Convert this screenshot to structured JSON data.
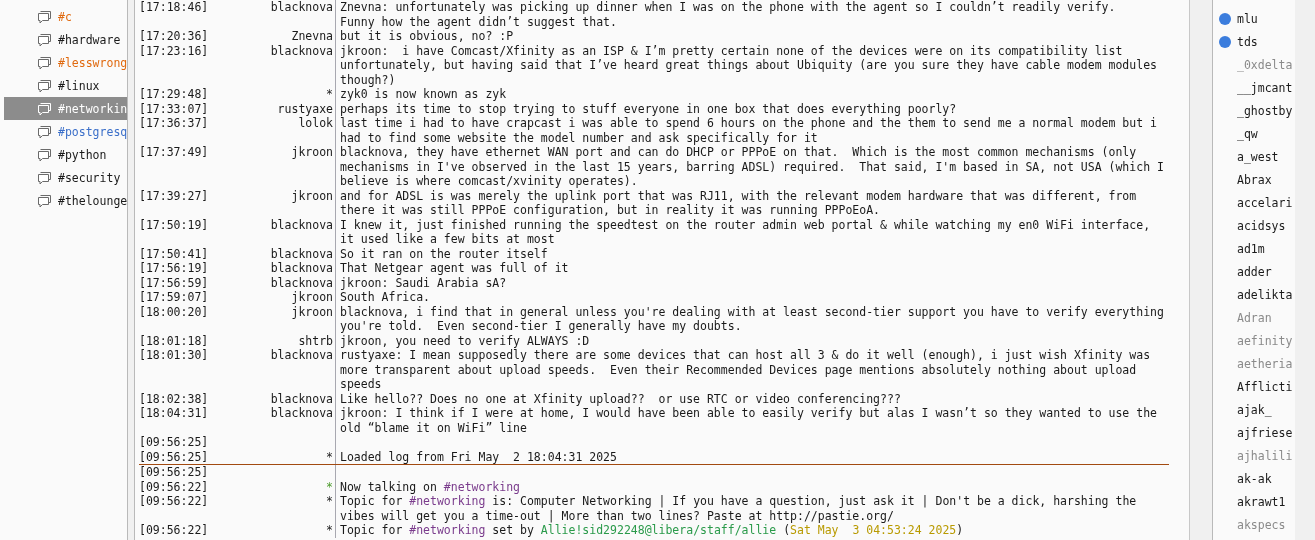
{
  "channels": [
    {
      "name": "#c",
      "color": "#e06a10",
      "selected": false
    },
    {
      "name": "#hardware",
      "color": "#1a1a1a",
      "selected": false
    },
    {
      "name": "#lesswrong",
      "color": "#e06a10",
      "selected": false
    },
    {
      "name": "#linux",
      "color": "#1a1a1a",
      "selected": false
    },
    {
      "name": "#networkin",
      "selected": true
    },
    {
      "name": "#postgresq",
      "color": "#3b6fc9",
      "selected": false
    },
    {
      "name": "#python",
      "color": "#1a1a1a",
      "selected": false
    },
    {
      "name": "#security",
      "color": "#1a1a1a",
      "selected": false
    },
    {
      "name": "#thelounge",
      "color": "#1a1a1a",
      "selected": false
    }
  ],
  "log": [
    {
      "kind": "line",
      "time": "[17:18:46]",
      "nick": "blacknova",
      "text": "Znevna: unfortunately was picking up dinner when I was on the phone with the agent so I couldn’t readily verify.\nFunny how the agent didn’t suggest that."
    },
    {
      "kind": "line",
      "time": "[17:20:36]",
      "nick": "Znevna",
      "text": "but it is obvious, no? :P"
    },
    {
      "kind": "line",
      "time": "[17:23:16]",
      "nick": "blacknova",
      "text": "jkroon:  i have Comcast/Xfinity as an ISP & I’m pretty certain none of the devices were on its compatibility list unfortunately, but having said that I’ve heard great things about Ubiquity (are you sure they have cable modem modules though?)"
    },
    {
      "kind": "line",
      "time": "[17:29:48]",
      "nick": "*",
      "text": "zyk0 is now known as zyk"
    },
    {
      "kind": "line",
      "time": "[17:33:07]",
      "nick": "rustyaxe",
      "text": "perhaps its time to stop trying to stuff everyone in one box that does everything poorly?"
    },
    {
      "kind": "line",
      "time": "[17:36:37]",
      "nick": "lolok",
      "text": "last time i had to have crapcast i was able to spend 6 hours on the phone and the them to send me a normal modem but i had to find some website the model number and ask specifically for it"
    },
    {
      "kind": "line",
      "time": "[17:37:49]",
      "nick": "jkroon",
      "text": "blacknova, they have ethernet WAN port and can do DHCP or PPPoE on that.  Which is the most common mechanisms (only mechanisms in I've observed in the last 15 years, barring ADSL) required.  That said, I'm based in SA, not USA (which I believe is where comcast/xvinity operates)."
    },
    {
      "kind": "line",
      "time": "[17:39:27]",
      "nick": "jkroon",
      "text": "and for ADSL is was merely the uplink port that was RJ11, with the relevant modem hardware that was different, from there it was still PPPoE configuration, but in reality it was running PPPoEoA."
    },
    {
      "kind": "line",
      "time": "[17:50:19]",
      "nick": "blacknova",
      "text": "I knew it, just finished running the speedtest on the router admin web portal & while watching my en0 WiFi interface, it used like a few bits at most"
    },
    {
      "kind": "line",
      "time": "[17:50:41]",
      "nick": "blacknova",
      "text": "So it ran on the router itself"
    },
    {
      "kind": "line",
      "time": "[17:56:19]",
      "nick": "blacknova",
      "text": "That Netgear agent was full of it"
    },
    {
      "kind": "line",
      "time": "[17:56:59]",
      "nick": "blacknova",
      "text": "jkroon: Saudi Arabia sA?"
    },
    {
      "kind": "line",
      "time": "[17:59:07]",
      "nick": "jkroon",
      "text": "South Africa."
    },
    {
      "kind": "line",
      "time": "[18:00:20]",
      "nick": "jkroon",
      "text": "blacknova, i find that in general unless you're dealing with at least second-tier support you have to verify everything you're told.  Even second-tier I generally have my doubts."
    },
    {
      "kind": "line",
      "time": "[18:01:18]",
      "nick": "shtrb",
      "text": "jkroon, you need to verify ALWAYS :D"
    },
    {
      "kind": "line",
      "time": "[18:01:30]",
      "nick": "blacknova",
      "text": "rustyaxe: I mean supposedly there are some devices that can host all 3 & do it well (enough), i just wish Xfinity was more transparent about upload speeds.  Even their Recommended Devices page mentions absolutely nothing about upload speeds"
    },
    {
      "kind": "line",
      "time": "[18:02:38]",
      "nick": "blacknova",
      "text": "Like hello?? Does no one at Xfinity upload??  or use RTC or video conferencing???"
    },
    {
      "kind": "line",
      "time": "[18:04:31]",
      "nick": "blacknova",
      "text": "jkroon: I think if I were at home, I would have been able to easily verify but alas I wasn’t so they wanted to use the old “blame it on WiFi” line"
    },
    {
      "kind": "line",
      "time": "[09:56:25]"
    },
    {
      "kind": "line",
      "time": "[09:56:25]",
      "nick": "*",
      "text": "Loaded log from Fri May  2 18:04:31 2025"
    },
    {
      "kind": "marker"
    },
    {
      "kind": "line",
      "time": "[09:56:25]"
    },
    {
      "kind": "line",
      "time": "[09:56:22]",
      "nick": "*",
      "nick_highlight": true,
      "parts": [
        {
          "kind": "text",
          "text": "Now talking on "
        },
        {
          "kind": "channel",
          "text": "#networking"
        }
      ]
    },
    {
      "kind": "line",
      "time": "[09:56:22]",
      "nick": "*",
      "parts": [
        {
          "kind": "text",
          "text": "Topic for "
        },
        {
          "kind": "channel",
          "text": "#networking"
        },
        {
          "kind": "text",
          "text": " is: Computer Networking | If you have a question, just ask it | Don't be a dick, harshing the vibes will get you a time-out | More than two lines? Paste at http://pastie.org/"
        }
      ]
    },
    {
      "kind": "line",
      "time": "[09:56:22]",
      "nick": "*",
      "parts": [
        {
          "kind": "text",
          "text": "Topic for "
        },
        {
          "kind": "channel",
          "text": "#networking"
        },
        {
          "kind": "text",
          "text": " set by "
        },
        {
          "kind": "host",
          "text": "Allie!sid292248@libera/staff/allie"
        },
        {
          "kind": "text",
          "text": " ("
        },
        {
          "kind": "date",
          "text": "Sat May  3 04:53:24 2025"
        },
        {
          "kind": "text",
          "text": ")"
        }
      ]
    }
  ],
  "users": [
    {
      "name": "mlu",
      "voiced": true,
      "away": false
    },
    {
      "name": "tds",
      "voiced": true,
      "away": false
    },
    {
      "name": "_0xdelta",
      "voiced": false,
      "away": true
    },
    {
      "name": "__jmcant",
      "voiced": false,
      "away": false
    },
    {
      "name": "_ghostby",
      "voiced": false,
      "away": false
    },
    {
      "name": "_qw",
      "voiced": false,
      "away": false
    },
    {
      "name": "a_west",
      "voiced": false,
      "away": false
    },
    {
      "name": "Abrax",
      "voiced": false,
      "away": false
    },
    {
      "name": "accelari",
      "voiced": false,
      "away": false
    },
    {
      "name": "acidsys",
      "voiced": false,
      "away": false
    },
    {
      "name": "ad1m",
      "voiced": false,
      "away": false
    },
    {
      "name": "adder",
      "voiced": false,
      "away": false
    },
    {
      "name": "adelikta",
      "voiced": false,
      "away": false
    },
    {
      "name": "Adran",
      "voiced": false,
      "away": true
    },
    {
      "name": "aefinity",
      "voiced": false,
      "away": true
    },
    {
      "name": "aetheria",
      "voiced": false,
      "away": true
    },
    {
      "name": "Afflicti",
      "voiced": false,
      "away": false
    },
    {
      "name": "ajak_",
      "voiced": false,
      "away": false
    },
    {
      "name": "ajfriese",
      "voiced": false,
      "away": false
    },
    {
      "name": "ajhalili",
      "voiced": false,
      "away": true
    },
    {
      "name": "ak-ak",
      "voiced": false,
      "away": false
    },
    {
      "name": "akrawt1",
      "voiced": false,
      "away": false
    },
    {
      "name": "akspecs",
      "voiced": false,
      "away": true
    }
  ]
}
